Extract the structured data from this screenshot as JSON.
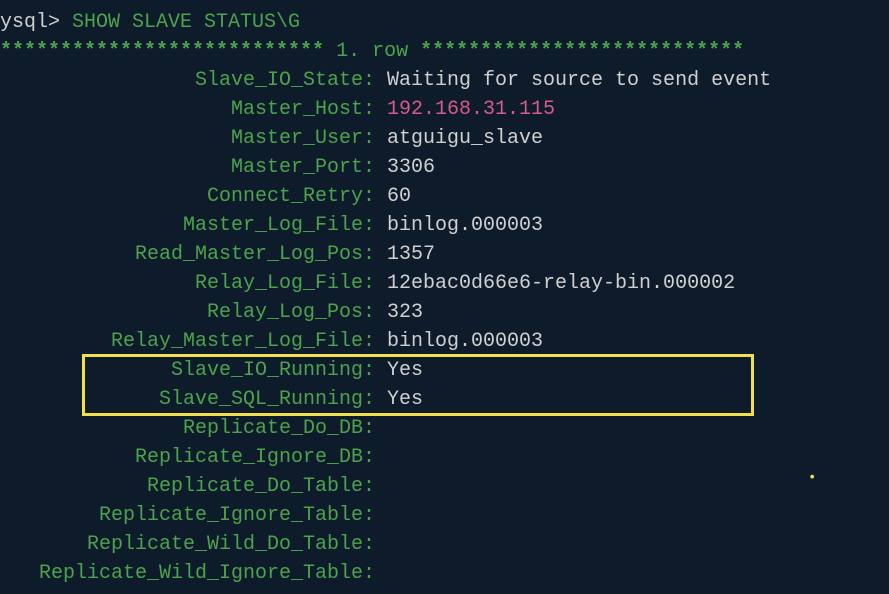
{
  "prompt": "ysql> ",
  "command": "SHOW SLAVE STATUS\\G",
  "separator_left": "*************************** ",
  "row_num": "1",
  "row_text": ". row ",
  "separator_right": "***************************",
  "fields": [
    {
      "label": "Slave_IO_State",
      "value": "Waiting for source to send event",
      "type": "normal"
    },
    {
      "label": "Master_Host",
      "value": "192.168.31.115",
      "type": "pink"
    },
    {
      "label": "Master_User",
      "value": "atguigu_slave",
      "type": "normal"
    },
    {
      "label": "Master_Port",
      "value": "3306",
      "type": "normal"
    },
    {
      "label": "Connect_Retry",
      "value": "60",
      "type": "normal"
    },
    {
      "label": "Master_Log_File",
      "value": "binlog.000003",
      "type": "normal"
    },
    {
      "label": "Read_Master_Log_Pos",
      "value": "1357",
      "type": "normal"
    },
    {
      "label": "Relay_Log_File",
      "value": "12ebac0d66e6-relay-bin.000002",
      "type": "normal"
    },
    {
      "label": "Relay_Log_Pos",
      "value": "323",
      "type": "normal"
    },
    {
      "label": "Relay_Master_Log_File",
      "value": "binlog.000003",
      "type": "normal"
    },
    {
      "label": "Slave_IO_Running",
      "value": "Yes",
      "type": "normal",
      "highlight": true
    },
    {
      "label": "Slave_SQL_Running",
      "value": "Yes",
      "type": "normal",
      "highlight": true
    },
    {
      "label": "Replicate_Do_DB",
      "value": "",
      "type": "normal"
    },
    {
      "label": "Replicate_Ignore_DB",
      "value": "",
      "type": "normal"
    },
    {
      "label": "Replicate_Do_Table",
      "value": "",
      "type": "normal"
    },
    {
      "label": "Replicate_Ignore_Table",
      "value": "",
      "type": "normal"
    },
    {
      "label": "Replicate_Wild_Do_Table",
      "value": "",
      "type": "normal"
    },
    {
      "label": "Replicate_Wild_Ignore_Table",
      "value": "",
      "type": "normal"
    }
  ]
}
